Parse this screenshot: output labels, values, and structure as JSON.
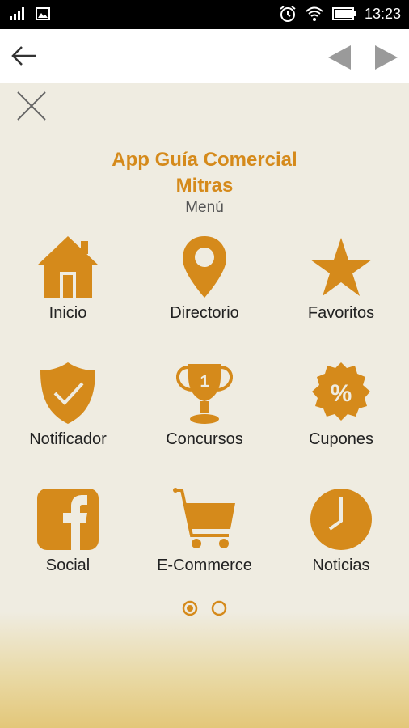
{
  "status_bar": {
    "time": "13:23",
    "icons": [
      "signal-icon",
      "image-icon",
      "alarm-icon",
      "wifi-icon",
      "battery-icon"
    ]
  },
  "toolbar": {
    "back_icon": "back-arrow-icon",
    "prev_icon": "prev-triangle-icon",
    "next_icon": "next-triangle-icon"
  },
  "header": {
    "title_line1": "App Guía Comercial",
    "title_line2": "Mitras",
    "subtitle": "Menú"
  },
  "menu": {
    "items": [
      {
        "label": "Inicio",
        "icon": "home-icon"
      },
      {
        "label": "Directorio",
        "icon": "map-pin-icon"
      },
      {
        "label": "Favoritos",
        "icon": "star-icon"
      },
      {
        "label": "Notificador",
        "icon": "shield-check-icon"
      },
      {
        "label": "Concursos",
        "icon": "trophy-icon"
      },
      {
        "label": "Cupones",
        "icon": "percent-badge-icon"
      },
      {
        "label": "Social",
        "icon": "facebook-icon"
      },
      {
        "label": "E-Commerce",
        "icon": "cart-icon"
      },
      {
        "label": "Noticias",
        "icon": "clock-icon"
      }
    ]
  },
  "pagination": {
    "current": 1,
    "total": 2
  },
  "colors": {
    "accent": "#d58a1b",
    "background": "#efece1"
  }
}
